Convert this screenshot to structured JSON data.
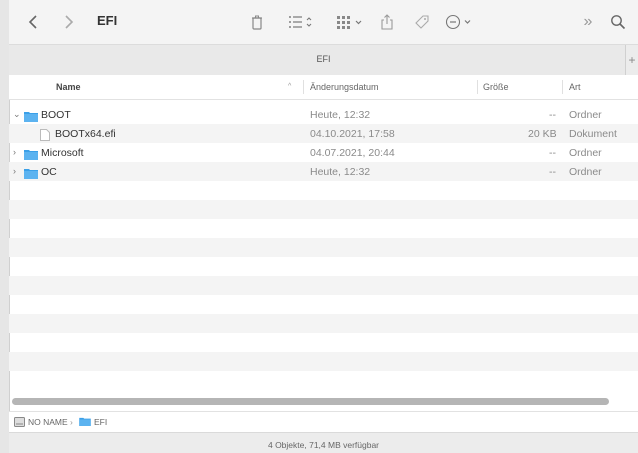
{
  "toolbar": {
    "title": "EFI",
    "icons": [
      "chevron-left-icon",
      "chevron-right-icon",
      "trash-icon",
      "list-view-icon",
      "grid-view-icon",
      "share-icon",
      "tag-icon",
      "more-icon",
      "overflow-icon",
      "search-icon"
    ],
    "more_label": "»"
  },
  "tab": {
    "label": "EFI",
    "plus": "+"
  },
  "columns": {
    "name": "Name",
    "date": "Änderungsdatum",
    "size": "Größe",
    "kind": "Art",
    "sort_indicator": "^"
  },
  "files": [
    {
      "name": "BOOT",
      "date": "Heute, 12:32",
      "size": "--",
      "kind": "Ordner",
      "type": "folder",
      "expanded": true,
      "indent": 0
    },
    {
      "name": "BOOTx64.efi",
      "date": "04.10.2021, 17:58",
      "size": "20 KB",
      "kind": "Dokument",
      "type": "file",
      "indent": 1
    },
    {
      "name": "Microsoft",
      "date": "04.07.2021, 20:44",
      "size": "--",
      "kind": "Ordner",
      "type": "folder",
      "expanded": false,
      "indent": 0
    },
    {
      "name": "OC",
      "date": "Heute, 12:32",
      "size": "--",
      "kind": "Ordner",
      "type": "folder",
      "expanded": false,
      "indent": 0
    }
  ],
  "pathbar": {
    "volume": "NO NAME",
    "separator": "›",
    "folder": "EFI"
  },
  "status": {
    "text": "4 Objekte, 71,4 MB verfügbar"
  },
  "colors": {
    "folder": "#3ba0e8",
    "selection_alt_row": "#f4f4f4",
    "toolbar_bg": "#f4f4f4"
  }
}
